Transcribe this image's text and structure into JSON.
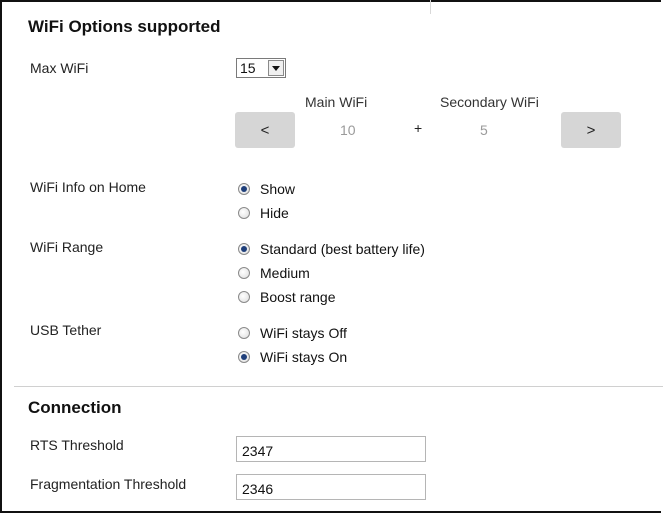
{
  "wifi_options": {
    "title": "WiFi Options supported",
    "max_wifi": {
      "label": "Max WiFi",
      "selected": "15"
    },
    "main_wifi": {
      "label": "Main WiFi",
      "value": "10"
    },
    "secondary_wifi": {
      "label": "Secondary WiFi",
      "value": "5"
    },
    "plus": "+",
    "prev_label": "<",
    "next_label": ">",
    "wifi_info_home": {
      "label": "WiFi Info on Home",
      "options": [
        {
          "label": "Show",
          "checked": true
        },
        {
          "label": "Hide",
          "checked": false
        }
      ]
    },
    "wifi_range": {
      "label": "WiFi Range",
      "options": [
        {
          "label": "Standard (best battery life)",
          "checked": true
        },
        {
          "label": "Medium",
          "checked": false
        },
        {
          "label": "Boost range",
          "checked": false
        }
      ]
    },
    "usb_tether": {
      "label": "USB Tether",
      "options": [
        {
          "label": "WiFi stays Off",
          "checked": false
        },
        {
          "label": "WiFi stays On",
          "checked": true
        }
      ]
    }
  },
  "connection": {
    "title": "Connection",
    "rts": {
      "label": "RTS Threshold",
      "value": "2347"
    },
    "fragmentation": {
      "label": "Fragmentation Threshold",
      "value": "2346"
    }
  }
}
